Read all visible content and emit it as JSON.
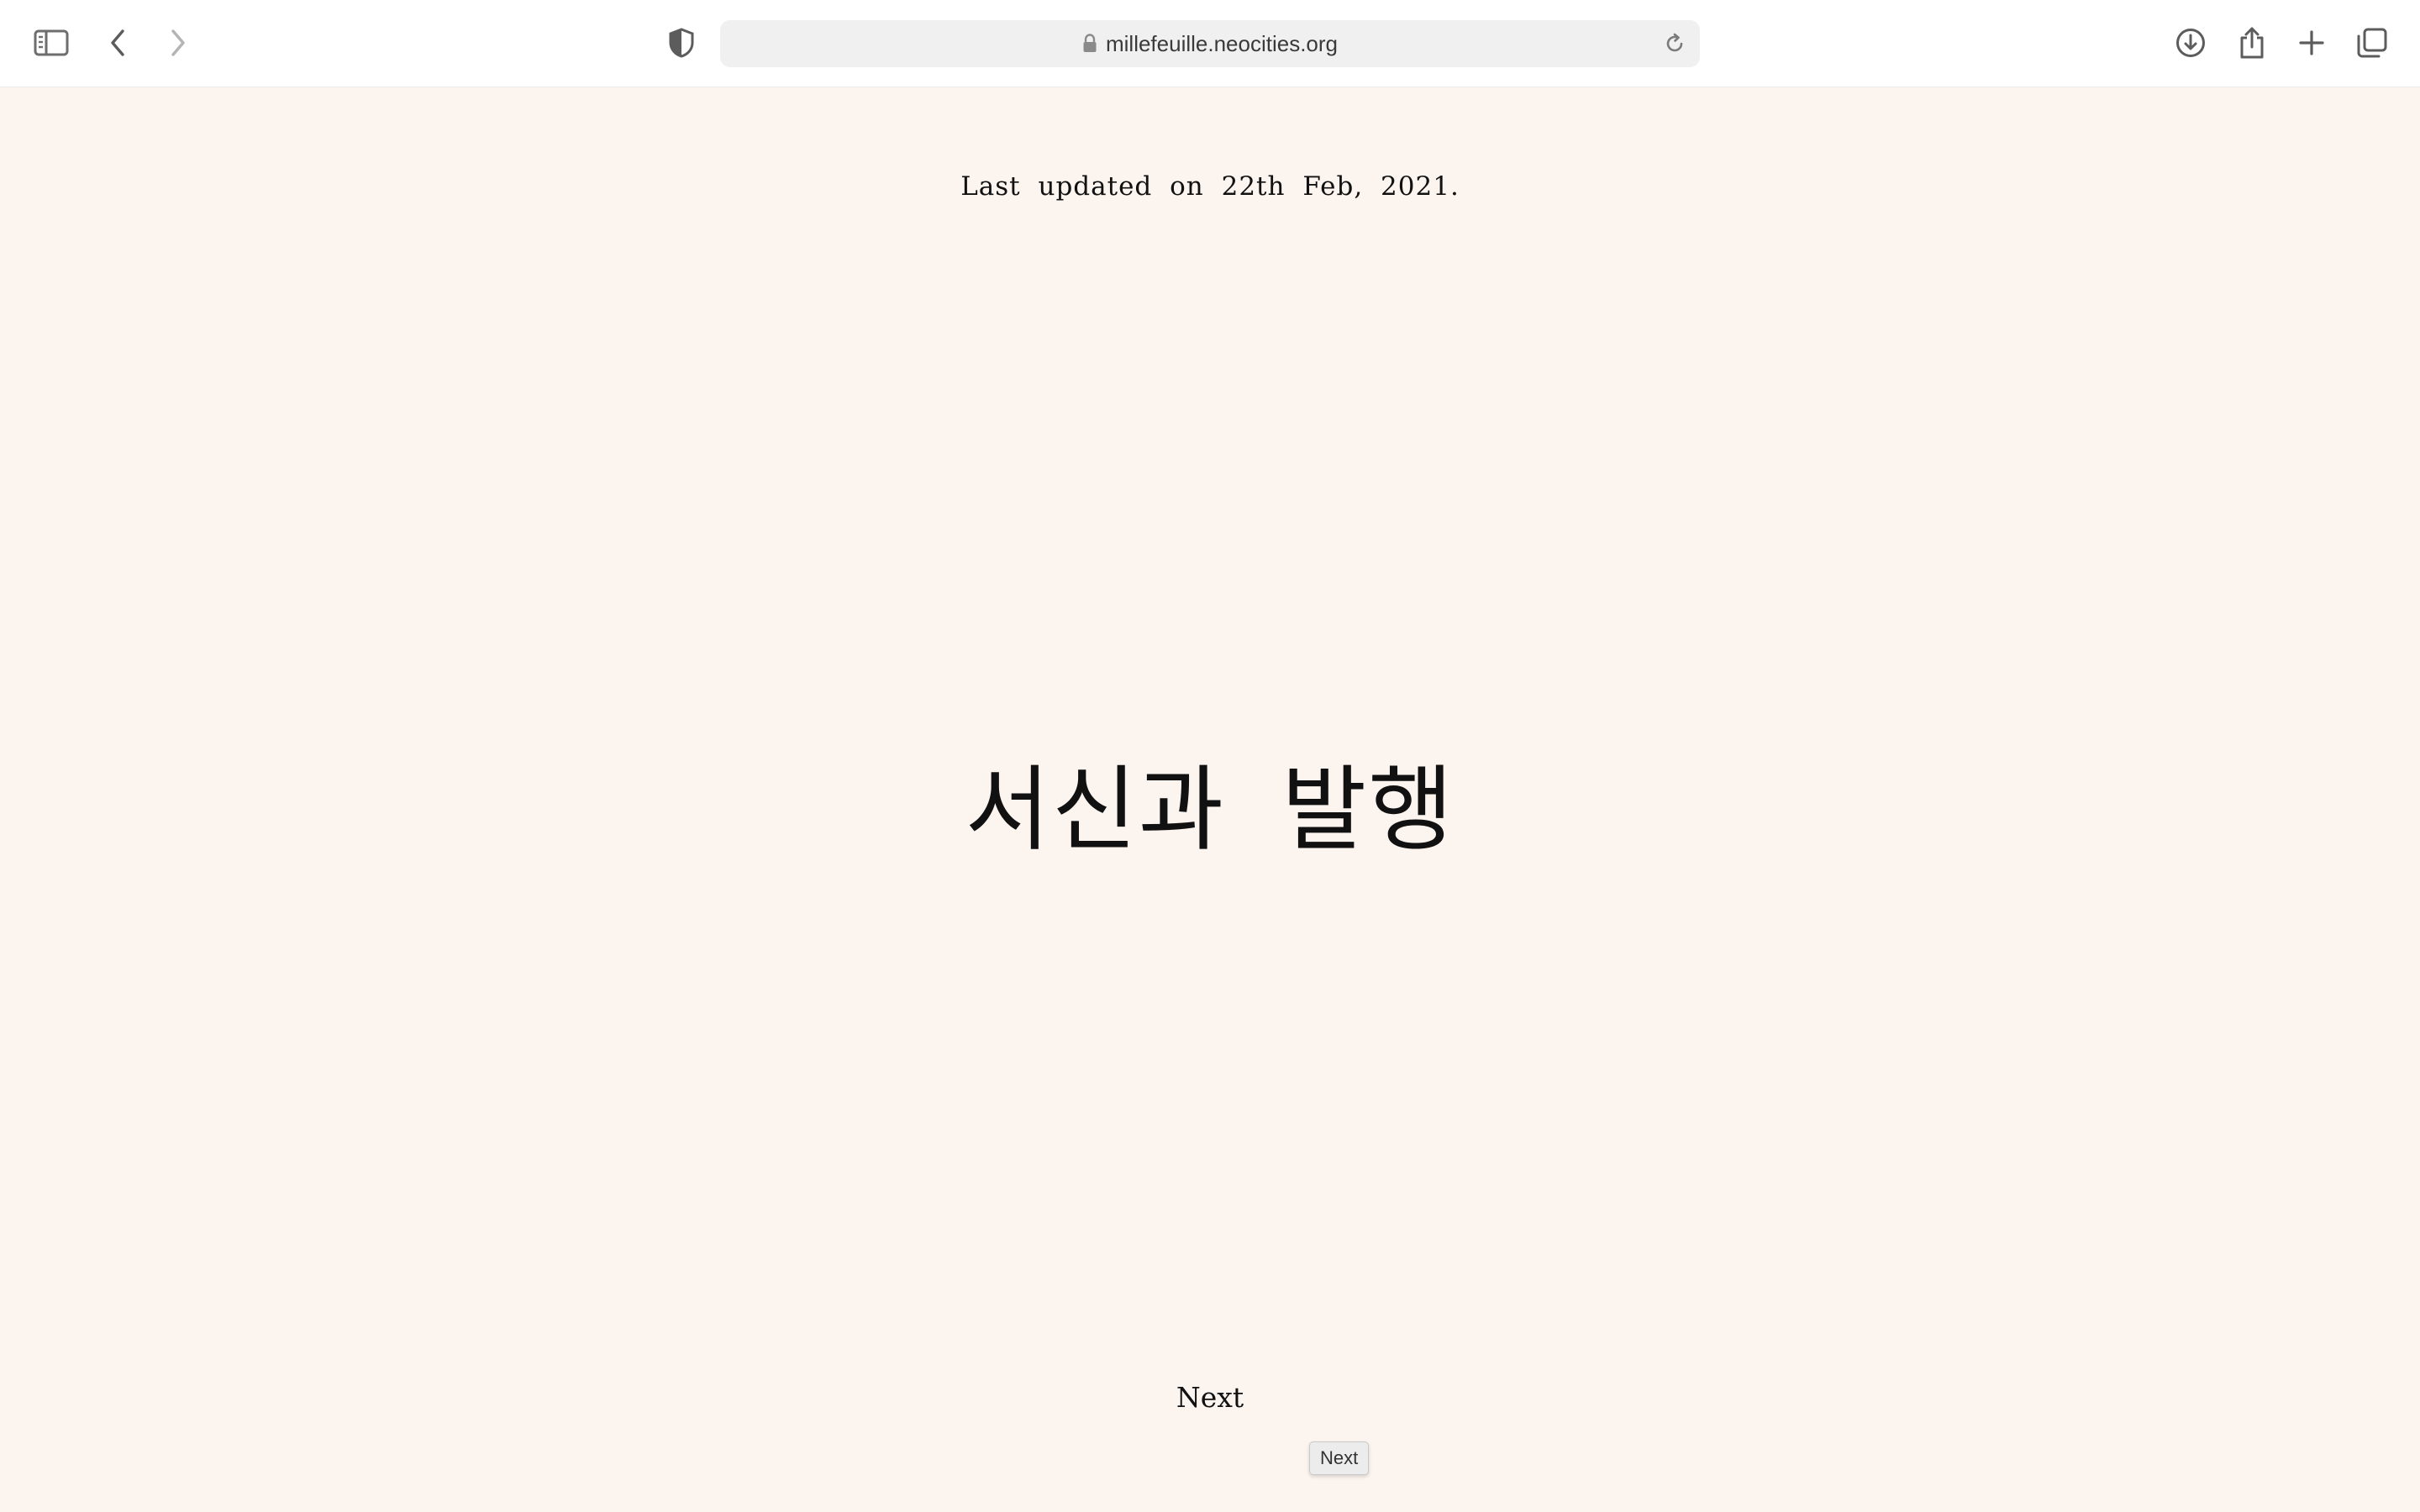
{
  "browser": {
    "url": "millefeuille.neocities.org",
    "icons": {
      "sidebar": "sidebar-icon",
      "back": "chevron-left-icon",
      "forward": "chevron-right-icon",
      "privacy": "shield-icon",
      "lock": "lock-icon",
      "reload": "reload-icon",
      "downloads": "download-icon",
      "share": "share-icon",
      "new_tab": "plus-icon",
      "tabs": "tabs-overview-icon"
    }
  },
  "page": {
    "last_updated": "Last updated on 22th Feb, 2021.",
    "title": "서신과 발행",
    "next_link": "Next",
    "tooltip": "Next",
    "background": "#fcf4ef"
  }
}
